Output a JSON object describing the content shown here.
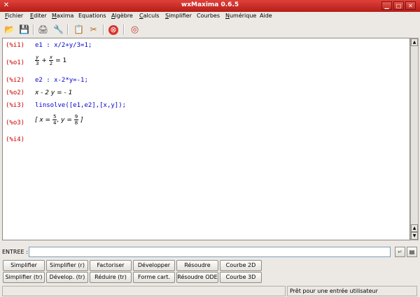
{
  "window": {
    "title": "wxMaxima 0.6.5"
  },
  "menu": [
    {
      "label": "Fichier",
      "u": "F",
      "rest": "ichier"
    },
    {
      "label": "Editer",
      "u": "E",
      "rest": "diter"
    },
    {
      "label": "Maxima",
      "u": "M",
      "rest": "axima"
    },
    {
      "label": "Equations",
      "u": "",
      "rest": "Equations"
    },
    {
      "label": "Algèbre",
      "u": "A",
      "rest": "lgèbre"
    },
    {
      "label": "Calculs",
      "u": "C",
      "rest": "alculs"
    },
    {
      "label": "Simplifier",
      "u": "S",
      "rest": "implifier"
    },
    {
      "label": "Courbes",
      "u": "",
      "rest": "Courbes"
    },
    {
      "label": "Numérique",
      "u": "N",
      "rest": "umérique"
    },
    {
      "label": "Aide",
      "u": "",
      "rest": "Aide"
    }
  ],
  "toolbar": [
    {
      "name": "open-icon",
      "glyph": "📂"
    },
    {
      "name": "save-icon",
      "glyph": "💾"
    },
    {
      "name": "print-icon",
      "glyph": "🖨"
    },
    {
      "name": "preferences-icon",
      "glyph": "🔧"
    },
    {
      "name": "copy-icon",
      "glyph": "📋"
    },
    {
      "name": "cut-icon",
      "glyph": "✂"
    },
    {
      "name": "interrupt-icon",
      "glyph": "⊗"
    },
    {
      "name": "help-icon",
      "glyph": "◎"
    }
  ],
  "cells": {
    "i1": {
      "label": "(%i1)",
      "code": "e1 : x/2+y/3=1;"
    },
    "o1": {
      "label": "(%o1)",
      "f1num": "y",
      "f1den": "3",
      "plus": "+",
      "f2num": "x",
      "f2den": "2",
      "rhs": "= 1"
    },
    "i2": {
      "label": "(%i2)",
      "code": "e2 : x-2*y=-1;"
    },
    "o2": {
      "label": "(%o2)",
      "expr": "x - 2 y = - 1"
    },
    "i3": {
      "label": "(%i3)",
      "code": "linsolve([e1,e2],[x,y]);"
    },
    "o3": {
      "label": "(%o3)",
      "open": "[ x =",
      "f1num": "5",
      "f1den": "4",
      "mid": ", y =",
      "f2num": "9",
      "f2den": "8",
      "close": "]"
    },
    "i4": {
      "label": "(%i4)"
    }
  },
  "entree": {
    "label": "ENTREE :",
    "value": ""
  },
  "buttons_row1": [
    "Simplifier",
    "Simplifier (r)",
    "Factoriser",
    "Développer",
    "Résoudre",
    "Courbe 2D"
  ],
  "buttons_row2": [
    "Simplifier (tr)",
    "Dévelop. (tr)",
    "Réduire (tr)",
    "Forme cart.",
    "Résoudre ODE",
    "Courbe 3D"
  ],
  "status": {
    "message": "Prêt pour une entrée utilisateur"
  }
}
